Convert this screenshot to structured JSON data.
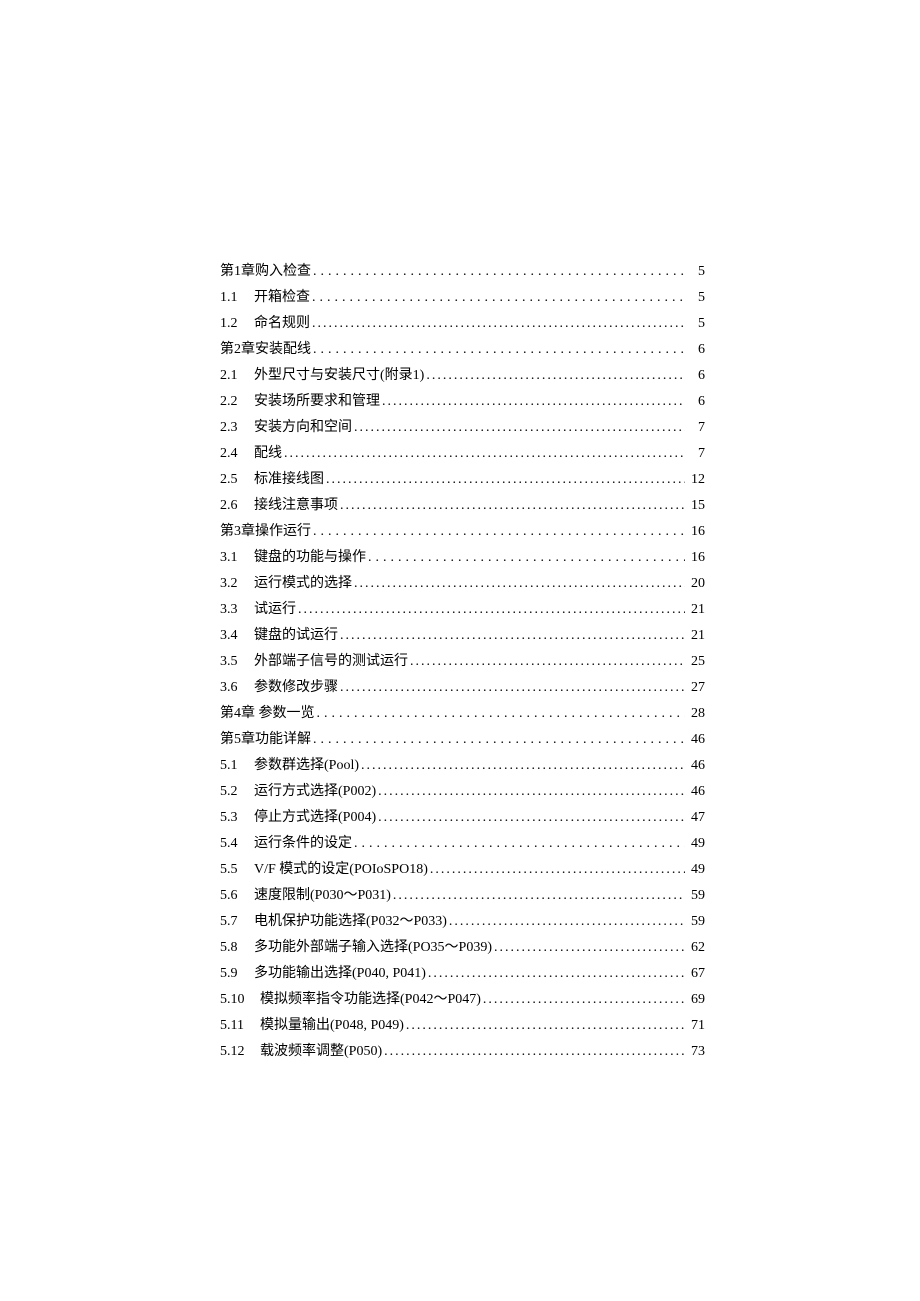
{
  "toc": [
    {
      "num": "",
      "title": "第1章购入检查",
      "page": "5",
      "leader": "wide"
    },
    {
      "num": "1.1",
      "title": "开箱检查",
      "page": "5",
      "leader": "wide"
    },
    {
      "num": "1.2",
      "title": "命名规则",
      "page": "5",
      "leader": "tight"
    },
    {
      "num": "",
      "title": "第2章安装配线",
      "page": "6",
      "leader": "wide"
    },
    {
      "num": "2.1",
      "title": "外型尺寸与安装尺寸(附录1)",
      "page": "6",
      "leader": "tight"
    },
    {
      "num": "2.2",
      "title": "安装场所要求和管理",
      "page": "6",
      "leader": "tight"
    },
    {
      "num": "2.3",
      "title": "安装方向和空间",
      "page": "7",
      "leader": "tight"
    },
    {
      "num": "2.4",
      "title": "配线",
      "page": "7",
      "leader": "tight"
    },
    {
      "num": "2.5",
      "title": "标准接线图",
      "page": "12",
      "leader": "tight"
    },
    {
      "num": "2.6",
      "title": "接线注意事项",
      "page": "15",
      "leader": "tight"
    },
    {
      "num": "",
      "title": "第3章操作运行",
      "page": "16",
      "leader": "wide"
    },
    {
      "num": "3.1",
      "title": "键盘的功能与操作",
      "page": "16",
      "leader": "wide"
    },
    {
      "num": "3.2",
      "title": "运行模式的选择",
      "page": "20",
      "leader": "tight"
    },
    {
      "num": "3.3",
      "title": "试运行",
      "page": "21",
      "leader": "tight"
    },
    {
      "num": "3.4",
      "title": "键盘的试运行",
      "page": "21",
      "leader": "tight"
    },
    {
      "num": "3.5",
      "title": "外部端子信号的测试运行",
      "page": "25",
      "leader": "tight"
    },
    {
      "num": "3.6",
      "title": "参数修改步骤",
      "page": "27",
      "leader": "tight"
    },
    {
      "num": "",
      "title": "第4章  参数一览",
      "page": "28",
      "leader": "wide"
    },
    {
      "num": "",
      "title": "第5章功能详解",
      "page": "46",
      "leader": "wide"
    },
    {
      "num": "5.1",
      "title": "参数群选择(Pool)",
      "page": "46",
      "leader": "tight"
    },
    {
      "num": "5.2",
      "title": "运行方式选择(P002)",
      "page": "46",
      "leader": "tight"
    },
    {
      "num": "5.3",
      "title": "停止方式选择(P004)",
      "page": "47",
      "leader": "tight"
    },
    {
      "num": "5.4",
      "title": "运行条件的设定",
      "page": "49",
      "leader": "wide"
    },
    {
      "num": "5.5",
      "title": "V/F 模式的设定(POIoSPO18)",
      "page": "49",
      "leader": "tight"
    },
    {
      "num": "5.6",
      "title": "速度限制(P030～P031)",
      "page": "59",
      "leader": "tight"
    },
    {
      "num": "5.7",
      "title": "电机保护功能选择(P032～P033)",
      "page": "59",
      "leader": "tight"
    },
    {
      "num": "5.8",
      "title": "多功能外部端子输入选择(PO35～P039)",
      "page": "62",
      "leader": "tight"
    },
    {
      "num": "5.9",
      "title": "多功能输出选择(P040, P041)",
      "page": "67",
      "leader": "tight"
    },
    {
      "num": "5.10",
      "title": "模拟频率指令功能选择(P042～P047)",
      "page": "69",
      "leader": "tight"
    },
    {
      "num": "5.11",
      "title": "模拟量输出(P048, P049)",
      "page": "71",
      "leader": "tight"
    },
    {
      "num": "5.12",
      "title": "载波频率调整(P050)",
      "page": "73",
      "leader": "tight"
    }
  ],
  "dots": "...................................................................................................................................................................."
}
